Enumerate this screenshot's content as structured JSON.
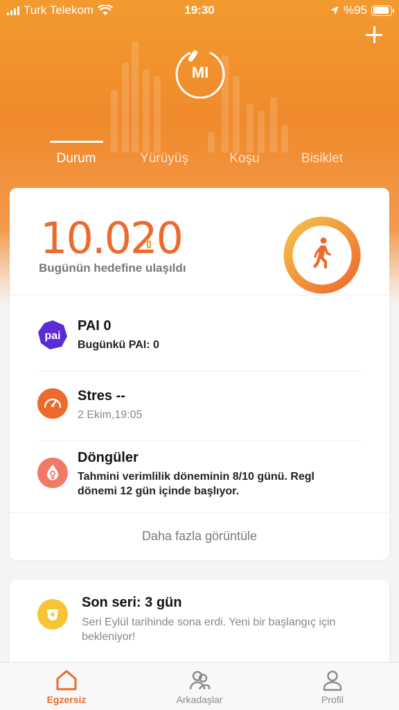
{
  "status_bar": {
    "carrier": "Turk Telekom",
    "time": "19:30",
    "battery": "%95"
  },
  "header": {
    "logo_text": "MI",
    "tabs": [
      {
        "label": "Durum",
        "active": true
      },
      {
        "label": "Yürüyüş",
        "active": false
      },
      {
        "label": "Koşu",
        "active": false
      },
      {
        "label": "Bisiklet",
        "active": false
      }
    ]
  },
  "summary": {
    "steps": "10.020",
    "goal_text": "Bugünün hedefine ulaşıldı",
    "goal_progress": 1.0
  },
  "metrics": [
    {
      "icon": "pai-icon",
      "icon_text": "pai",
      "title": "PAI 0",
      "subtitle": "Bugünkü PAI: 0",
      "color": "#5b2bd6"
    },
    {
      "icon": "gauge-icon",
      "title": "Stres --",
      "subtitle": "2 Ekim,19:05",
      "color": "#ec6a2c"
    },
    {
      "icon": "female-icon",
      "title": "Döngüler",
      "subtitle": "Tahmini verimlilik döneminin 8/10 günü. Regl dönemi 12 gün içinde başlıyor.",
      "color": "#f07a66"
    }
  ],
  "more_label": "Daha fazla görüntüle",
  "streak": {
    "title": "Son seri: 3 gün",
    "subtitle": "Seri Eylül tarihinde sona erdi. Yeni bir başlangıç için bekleniyor!",
    "icon_color": "#f7c534"
  },
  "bottom_nav": [
    {
      "label": "Egzersiz",
      "icon": "home-icon",
      "active": true
    },
    {
      "label": "Arkadaşlar",
      "icon": "friends-icon",
      "active": false
    },
    {
      "label": "Profil",
      "icon": "profile-icon",
      "active": false
    }
  ],
  "colors": {
    "accent": "#ec6a2c",
    "hero": "#f08a2c"
  }
}
